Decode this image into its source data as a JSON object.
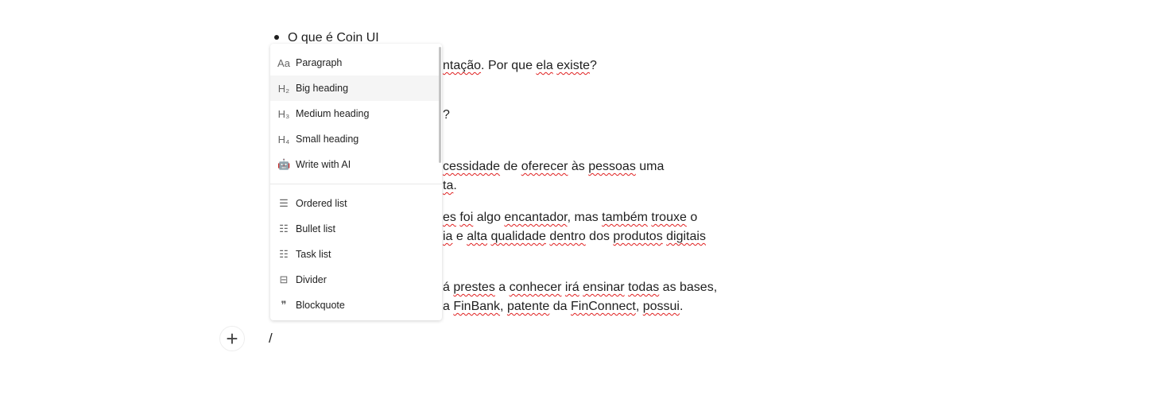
{
  "editor": {
    "bullet_text": "O que é Coin UI",
    "fragments": [
      [
        "ntação",
        ". Por que ",
        "ela",
        " ",
        "existe",
        "?"
      ],
      [
        "?"
      ],
      [
        "cessidade",
        " de ",
        "oferecer",
        " às ",
        "pessoas",
        " ",
        "uma"
      ],
      [
        "ta",
        "."
      ],
      [
        "es",
        " ",
        "foi",
        " algo ",
        "encantador",
        ", mas ",
        "também",
        " ",
        "trouxe",
        " o"
      ],
      [
        "ia",
        " e ",
        "alta",
        " ",
        "qualidade",
        " ",
        "dentro",
        " dos ",
        "produtos",
        " ",
        "digitais"
      ],
      [
        "á",
        " ",
        "prestes",
        " a ",
        "conhecer",
        " ",
        "irá",
        " ",
        "ensinar",
        " ",
        "todas",
        " as bases,"
      ],
      [
        "a ",
        "FinBank",
        ", ",
        "patente",
        " da ",
        "FinConnect",
        ", ",
        "possui",
        "."
      ]
    ],
    "slash_input": "/"
  },
  "menu": {
    "items": [
      {
        "label": "Paragraph",
        "icon": "Aa"
      },
      {
        "label": "Big heading",
        "icon": "H₂"
      },
      {
        "label": "Medium heading",
        "icon": "H₃"
      },
      {
        "label": "Small heading",
        "icon": "H₄"
      },
      {
        "label": "Write with AI",
        "icon": "🤖"
      },
      {
        "label": "Ordered list",
        "icon": "☰"
      },
      {
        "label": "Bullet list",
        "icon": "☷"
      },
      {
        "label": "Task list",
        "icon": "☷"
      },
      {
        "label": "Divider",
        "icon": "⊟"
      },
      {
        "label": "Blockquote",
        "icon": "❞"
      }
    ],
    "highlighted": "Big heading"
  },
  "colors": {
    "spellcheck": "#e02020",
    "highlight": "#f5f5f5"
  }
}
